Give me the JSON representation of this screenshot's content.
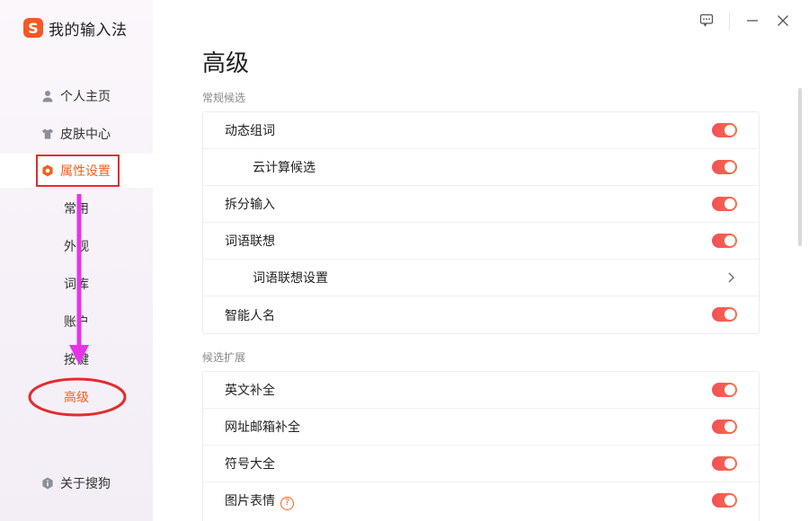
{
  "app": {
    "title": "我的输入法",
    "logo_letter": "S"
  },
  "sidebar": {
    "items": [
      {
        "label": "个人主页",
        "icon": "user-icon"
      },
      {
        "label": "皮肤中心",
        "icon": "tshirt-icon"
      },
      {
        "label": "属性设置",
        "icon": "hexagon-gear-icon",
        "active": true
      }
    ],
    "subitems": [
      {
        "label": "常用"
      },
      {
        "label": "外观"
      },
      {
        "label": "词库"
      },
      {
        "label": "账户"
      },
      {
        "label": "按键"
      },
      {
        "label": "高级",
        "active": true
      }
    ],
    "about": {
      "label": "关于搜狗",
      "icon": "info-shield-icon"
    }
  },
  "titlebar": {
    "buttons": [
      "feedback-icon",
      "minimize-icon",
      "close-icon"
    ]
  },
  "main": {
    "title": "高级",
    "sections": [
      {
        "label": "常规候选",
        "rows": [
          {
            "label": "动态组词",
            "control": "toggle",
            "on": true
          },
          {
            "label": "云计算候选",
            "control": "toggle",
            "on": true,
            "indent": true
          },
          {
            "label": "拆分输入",
            "control": "toggle",
            "on": true
          },
          {
            "label": "词语联想",
            "control": "toggle",
            "on": true
          },
          {
            "label": "词语联想设置",
            "control": "chevron",
            "indent": true
          },
          {
            "label": "智能人名",
            "control": "toggle",
            "on": true
          }
        ]
      },
      {
        "label": "候选扩展",
        "rows": [
          {
            "label": "英文补全",
            "control": "toggle",
            "on": true
          },
          {
            "label": "网址邮箱补全",
            "control": "toggle",
            "on": true
          },
          {
            "label": "符号大全",
            "control": "toggle",
            "on": true
          },
          {
            "label": "图片表情",
            "control": "toggle",
            "on": true,
            "help": "?"
          }
        ]
      }
    ]
  },
  "colors": {
    "accent": "#f0611f",
    "toggle_start": "#f24f56",
    "toggle_end": "#f7704b",
    "annotation_red": "#e12d2d",
    "annotation_arrow": "#e534e8"
  }
}
